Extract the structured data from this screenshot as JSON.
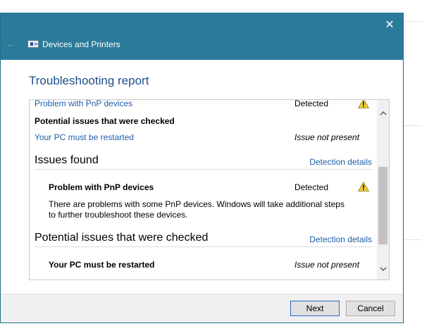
{
  "window": {
    "app_title": "Devices and Printers",
    "close_glyph": "✕",
    "back_glyph": "←"
  },
  "report": {
    "heading": "Troubleshooting report",
    "top_rows": {
      "clipped_problem": "Problem with PnP devices",
      "clipped_status": "Detected",
      "potential_header": "Potential issues that were checked",
      "restart_link": "Your PC must be restarted",
      "restart_status": "Issue not present"
    },
    "issues_found": {
      "title": "Issues found",
      "details_link": "Detection details",
      "problem_name": "Problem with PnP devices",
      "problem_status": "Detected",
      "description_line1": "There are problems with some PnP devices. Windows will take additional steps",
      "description_line2": "to further troubleshoot these devices."
    },
    "potential_issues": {
      "title": "Potential issues that were checked",
      "details_link": "Detection details",
      "item_name": "Your PC must be restarted",
      "item_status": "Issue not present"
    }
  },
  "scrollbar": {
    "up_glyph": "⌃",
    "down_glyph": "⌄"
  },
  "footer": {
    "next_label": "Next",
    "cancel_label": "Cancel"
  },
  "colors": {
    "titlebar": "#2b7a99",
    "link": "#1f5fa8",
    "heading": "#1f4d8f",
    "warning": "#f5d23a"
  },
  "icons": {
    "app_icon": "devices-and-printers-icon",
    "warning_icon": "warning-icon"
  }
}
